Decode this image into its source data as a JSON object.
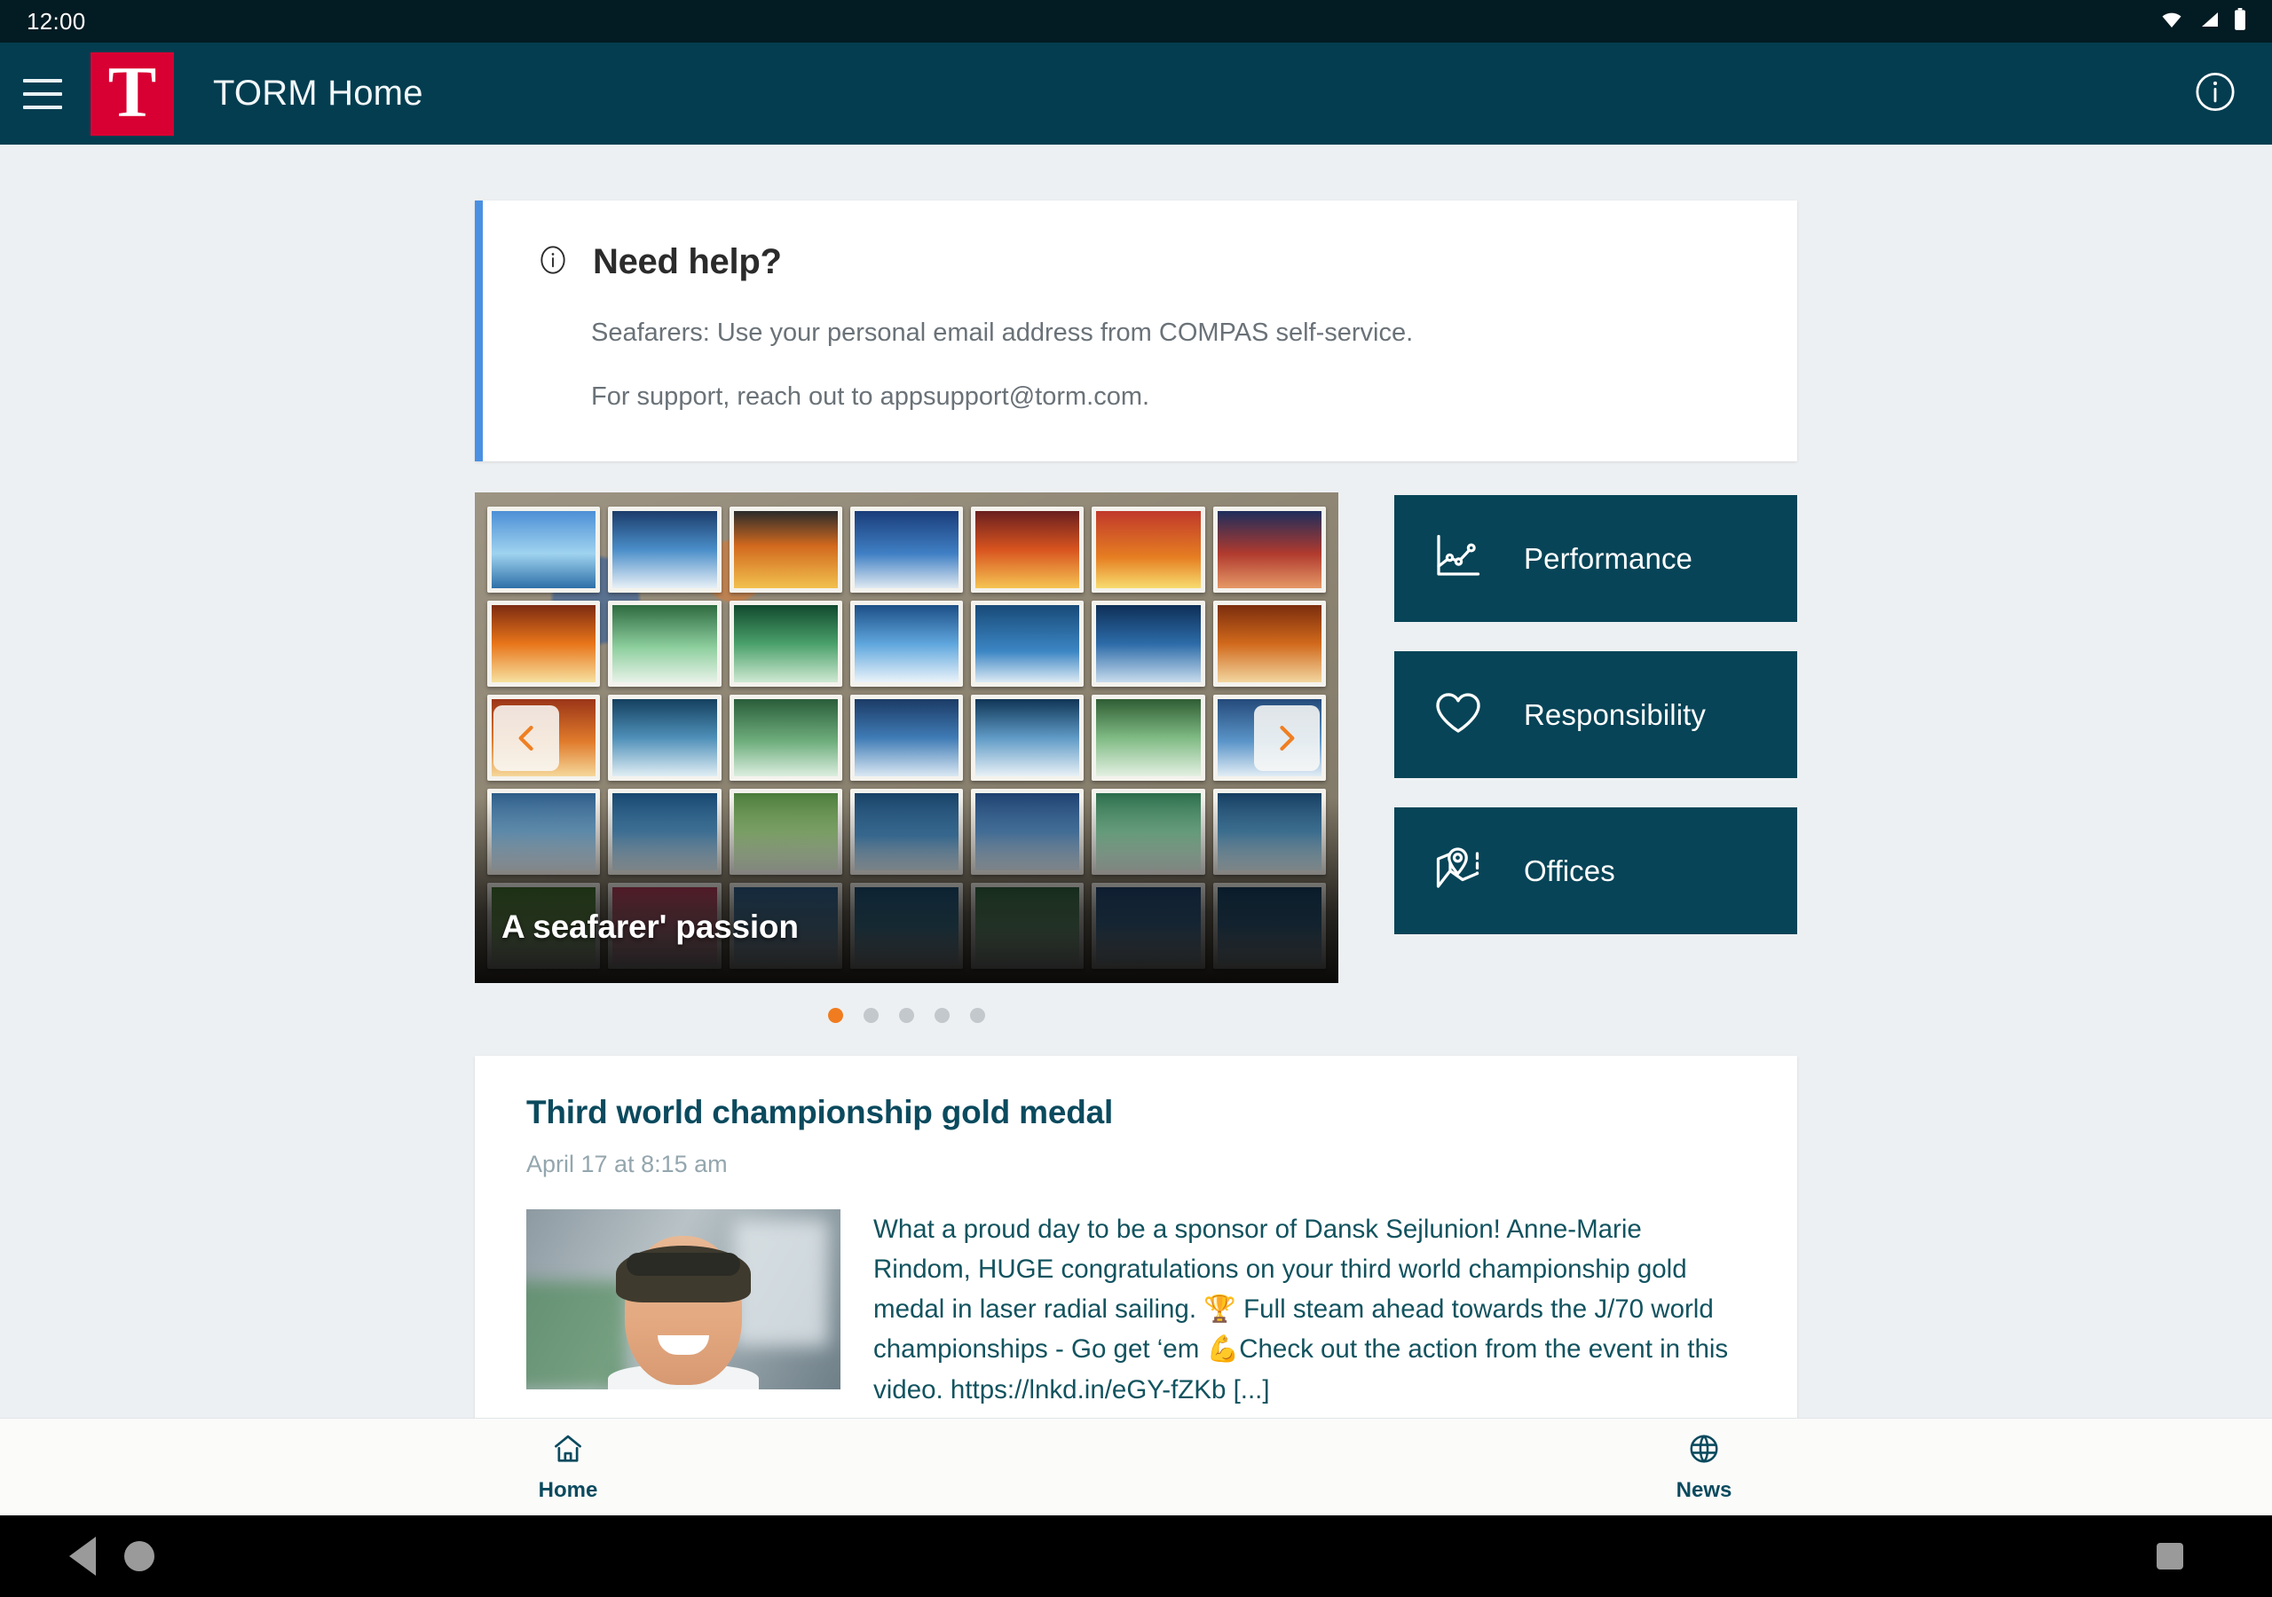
{
  "status_bar": {
    "clock": "12:00",
    "icons": [
      "wifi-icon",
      "signal-icon",
      "battery-icon"
    ]
  },
  "app_bar": {
    "menu_icon": "hamburger-menu-icon",
    "logo_letter": "T",
    "title": "TORM Home",
    "info_icon": "info-circle-icon"
  },
  "help_card": {
    "icon": "info-circle-icon",
    "title": "Need help?",
    "line1": "Seafarers: Use your personal email address from COMPAS self-service.",
    "line2": "For support, reach out to appsupport@torm.com."
  },
  "carousel": {
    "caption": "A seafarer' passion",
    "prev_icon": "chevron-left-icon",
    "next_icon": "chevron-right-icon",
    "dot_count": 5,
    "active_dot": 0
  },
  "tiles": [
    {
      "label": "Performance",
      "icon": "line-chart-icon"
    },
    {
      "label": "Responsibility",
      "icon": "heart-icon"
    },
    {
      "label": "Offices",
      "icon": "map-pin-icon"
    }
  ],
  "news": {
    "title": "Third world championship gold medal",
    "date": "April 17 at 8:15 am",
    "thumbnail": "portrait-photo",
    "body": "What a proud day to be a sponsor of Dansk Sejlunion! Anne-Marie Rindom, HUGE congratulations on your third world championship gold medal in laser radial sailing. 🏆 Full steam ahead towards the J/70 world championships - Go get ‘em 💪Check out the action from the event in this video. https://lnkd.in/eGY-fZKb [...]"
  },
  "tab_bar": [
    {
      "label": "Home",
      "icon": "house-icon",
      "active": true
    },
    {
      "label": "News",
      "icon": "globe-icon",
      "active": false
    }
  ],
  "android_nav": {
    "back_icon": "triangle-back-icon",
    "home_icon": "circle-home-icon",
    "recents_icon": "square-recents-icon"
  },
  "colors": {
    "app_bar": "#043d50",
    "logo_red": "#d80032",
    "tile": "#074457",
    "accent_orange": "#f07c1f",
    "accent_blue": "#4a90e2",
    "page_bg": "#edf0f2",
    "news_text": "#12535f"
  }
}
